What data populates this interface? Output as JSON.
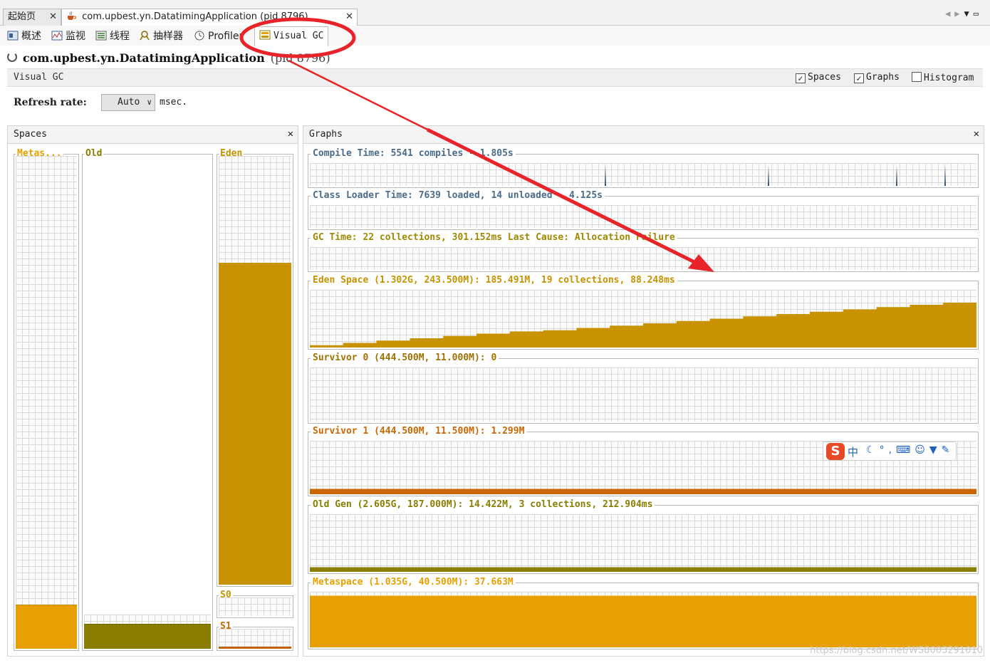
{
  "doc_tabs": [
    {
      "label": "起始页"
    },
    {
      "label": "com.upbest.yn.DatatimingApplication (pid 8796)"
    }
  ],
  "sub_tabs": [
    {
      "label": "概述",
      "icon": "overview-icon"
    },
    {
      "label": "监视",
      "icon": "monitor-icon"
    },
    {
      "label": "线程",
      "icon": "threads-icon"
    },
    {
      "label": "抽样器",
      "icon": "sampler-icon"
    },
    {
      "label": "Profiler",
      "icon": "profiler-icon"
    },
    {
      "label": "Visual GC",
      "icon": "visual-gc-icon"
    }
  ],
  "header": {
    "app_name": "com.upbest.yn.DatatimingApplication",
    "pid": "(pid 8796)"
  },
  "visual_gc": {
    "label": "Visual GC",
    "options": [
      {
        "label": "Spaces",
        "checked": true
      },
      {
        "label": "Graphs",
        "checked": true
      },
      {
        "label": "Histogram",
        "checked": false
      }
    ]
  },
  "refresh": {
    "label": "Refresh rate:",
    "value": "Auto",
    "unit": "msec."
  },
  "spaces_panel": {
    "title": "Spaces",
    "spaces": [
      {
        "label": "Metas...",
        "fill": 0.09,
        "grid_fraction": 1.0,
        "color": "#e8a000"
      },
      {
        "label": "Old",
        "fill": 0.05,
        "grid_fraction": 0.07,
        "color": "#8a7d00"
      },
      {
        "label": "Eden",
        "fill": 0.75,
        "grid_fraction": 1.0,
        "color": "#c89200"
      },
      {
        "label": "S0",
        "fill": 0.0,
        "grid_fraction": 1.0,
        "color": "#c89200"
      },
      {
        "label": "S1",
        "fill": 0.12,
        "grid_fraction": 1.0,
        "color": "#cc6600"
      }
    ]
  },
  "graphs_panel": {
    "title": "Graphs",
    "graphs": [
      {
        "label": "Compile Time: 5541 compiles - 1.805s",
        "color": "#4a6b8a",
        "kind": "spikes",
        "spikes": [
          0.443,
          0.688,
          0.88,
          0.953
        ]
      },
      {
        "label": "Class Loader Time: 7639 loaded, 14 unloaded - 4.125s",
        "color": "#4a6b8a",
        "kind": "empty"
      },
      {
        "label": "GC Time: 22 collections, 301.152ms Last Cause: Allocation Failure",
        "color": "#a08800",
        "kind": "empty"
      },
      {
        "label": "Eden Space (1.302G, 243.500M): 185.491M, 19 collections, 88.248ms",
        "color": "#c89200",
        "kind": "ramp",
        "series": [
          0.04,
          0.08,
          0.12,
          0.16,
          0.2,
          0.24,
          0.28,
          0.3,
          0.34,
          0.38,
          0.42,
          0.46,
          0.5,
          0.54,
          0.58,
          0.62,
          0.66,
          0.7,
          0.74,
          0.78
        ]
      },
      {
        "label": "Survivor 0 (444.500M, 11.000M): 0",
        "color": "#a07000",
        "kind": "empty"
      },
      {
        "label": "Survivor 1 (444.500M, 11.500M): 1.299M",
        "color": "#cc6600",
        "kind": "flat",
        "level": 0.1
      },
      {
        "label": "Old Gen (2.605G, 187.000M): 14.422M, 3 collections, 212.904ms",
        "color": "#8a7d00",
        "kind": "flat",
        "level": 0.08
      },
      {
        "label": "Metaspace (1.035G, 40.500M): 37.663M",
        "color": "#e8a000",
        "kind": "flat",
        "level": 0.93
      }
    ]
  },
  "ime_toolbar": {
    "logo": "S",
    "mode": "中",
    "icons": [
      "moon-icon",
      "punctuation-icon",
      "keyboard-icon",
      "user-icon",
      "shirt-icon",
      "wrench-icon"
    ]
  },
  "watermark": "https://blog.csdn.net/WS8003291010",
  "colors": {
    "annotation_red": "#e8242a"
  }
}
